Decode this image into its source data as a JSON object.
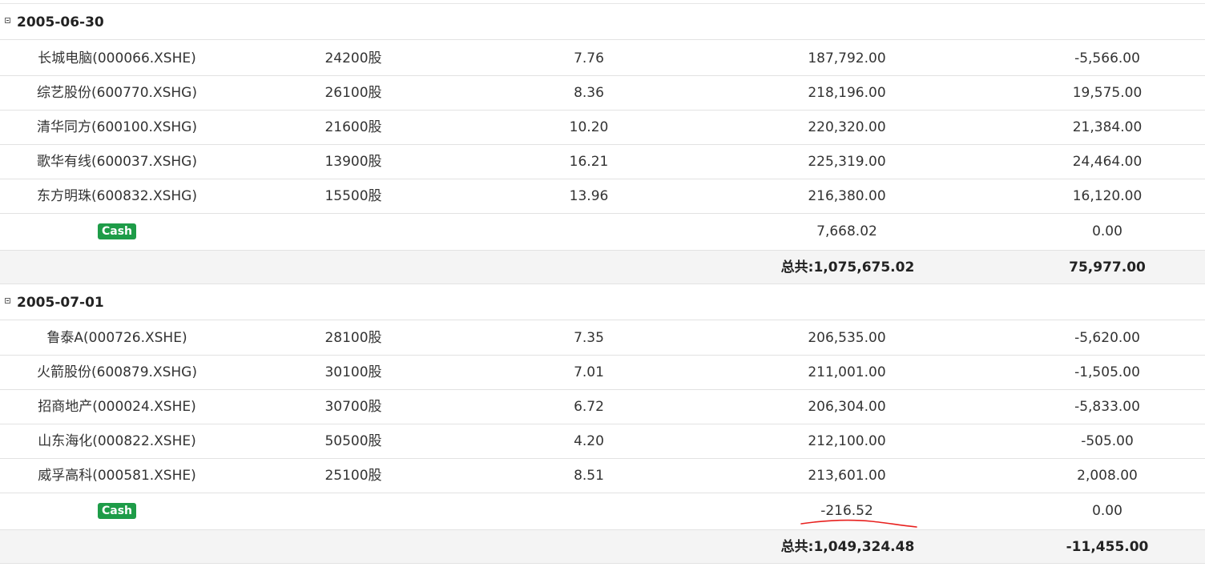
{
  "groups": [
    {
      "date": "2005-06-30",
      "rows": [
        {
          "name": "长城电脑(000066.XSHE)",
          "shares": "24200股",
          "price": "7.76",
          "value": "187,792.00",
          "pnl": "-5,566.00"
        },
        {
          "name": "综艺股份(600770.XSHG)",
          "shares": "26100股",
          "price": "8.36",
          "value": "218,196.00",
          "pnl": "19,575.00"
        },
        {
          "name": "清华同方(600100.XSHG)",
          "shares": "21600股",
          "price": "10.20",
          "value": "220,320.00",
          "pnl": "21,384.00"
        },
        {
          "name": "歌华有线(600037.XSHG)",
          "shares": "13900股",
          "price": "16.21",
          "value": "225,319.00",
          "pnl": "24,464.00"
        },
        {
          "name": "东方明珠(600832.XSHG)",
          "shares": "15500股",
          "price": "13.96",
          "value": "216,380.00",
          "pnl": "16,120.00"
        }
      ],
      "cash": {
        "label": "Cash",
        "value": "7,668.02",
        "pnl": "0.00"
      },
      "total": {
        "value": "总共:1,075,675.02",
        "pnl": "75,977.00"
      }
    },
    {
      "date": "2005-07-01",
      "rows": [
        {
          "name": "鲁泰A(000726.XSHE)",
          "shares": "28100股",
          "price": "7.35",
          "value": "206,535.00",
          "pnl": "-5,620.00"
        },
        {
          "name": "火箭股份(600879.XSHG)",
          "shares": "30100股",
          "price": "7.01",
          "value": "211,001.00",
          "pnl": "-1,505.00"
        },
        {
          "name": "招商地产(000024.XSHE)",
          "shares": "30700股",
          "price": "6.72",
          "value": "206,304.00",
          "pnl": "-5,833.00"
        },
        {
          "name": "山东海化(000822.XSHE)",
          "shares": "50500股",
          "price": "4.20",
          "value": "212,100.00",
          "pnl": "-505.00"
        },
        {
          "name": "威孚高科(000581.XSHE)",
          "shares": "25100股",
          "price": "8.51",
          "value": "213,601.00",
          "pnl": "2,008.00"
        }
      ],
      "cash": {
        "label": "Cash",
        "value": "-216.52",
        "pnl": "0.00"
      },
      "total": {
        "value": "总共:1,049,324.48",
        "pnl": "-11,455.00"
      }
    }
  ],
  "colors": {
    "cash_badge": "#1e9c48",
    "total_bg": "#f4f4f4",
    "annotation": "#e8201e"
  }
}
